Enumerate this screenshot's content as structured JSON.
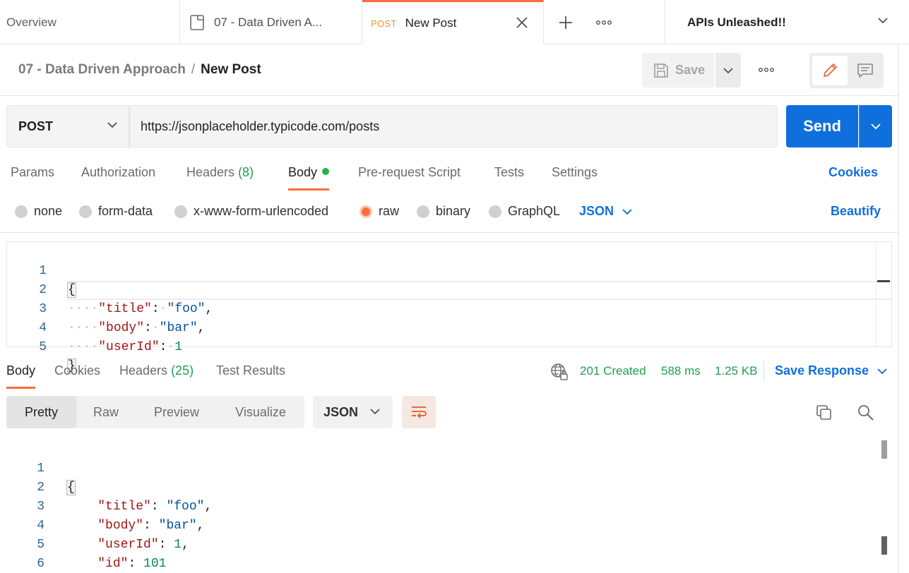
{
  "tabs": {
    "overview": "Overview",
    "collection": "07 - Data Driven A...",
    "new_post_method": "POST",
    "new_post": "New Post"
  },
  "workspace": "APIs Unleashed!!",
  "breadcrumb": {
    "collection": "07 - Data Driven Approach",
    "separator": "/",
    "request": "New Post"
  },
  "header": {
    "save_label": "Save"
  },
  "request": {
    "method": "POST",
    "url": "https://jsonplaceholder.typicode.com/posts",
    "send_label": "Send"
  },
  "request_tabs": [
    {
      "label": "Params"
    },
    {
      "label": "Authorization"
    },
    {
      "label": "Headers",
      "count": "(8)"
    },
    {
      "label": "Body"
    },
    {
      "label": "Pre-request Script"
    },
    {
      "label": "Tests"
    },
    {
      "label": "Settings"
    }
  ],
  "cookies_label": "Cookies",
  "body_types": [
    "none",
    "form-data",
    "x-www-form-urlencoded",
    "raw",
    "binary",
    "GraphQL"
  ],
  "body_format": "JSON",
  "beautify_label": "Beautify",
  "request_body_lines": [
    {
      "n": "1",
      "text": "{"
    },
    {
      "n": "2",
      "key": "\"title\"",
      "val": "\"foo\"",
      "end": ","
    },
    {
      "n": "3",
      "key": "\"body\"",
      "val": "\"bar\"",
      "end": ","
    },
    {
      "n": "4",
      "key": "\"userId\"",
      "num": "1",
      "end": ""
    },
    {
      "n": "5",
      "text": "}"
    }
  ],
  "response_tabs": [
    {
      "label": "Body"
    },
    {
      "label": "Cookies"
    },
    {
      "label": "Headers",
      "count": "(25)"
    },
    {
      "label": "Test Results"
    }
  ],
  "response_status": {
    "status": "201 Created",
    "time": "588 ms",
    "size": "1.25 KB"
  },
  "save_response_label": "Save Response",
  "view_modes": [
    "Pretty",
    "Raw",
    "Preview",
    "Visualize"
  ],
  "response_format": "JSON",
  "response_body_lines": [
    {
      "n": "1",
      "text": "{"
    },
    {
      "n": "2",
      "key": "\"title\"",
      "val": "\"foo\"",
      "end": ","
    },
    {
      "n": "3",
      "key": "\"body\"",
      "val": "\"bar\"",
      "end": ","
    },
    {
      "n": "4",
      "key": "\"userId\"",
      "num": "1",
      "end": ","
    },
    {
      "n": "5",
      "key": "\"id\"",
      "num": "101",
      "end": ""
    },
    {
      "n": "6",
      "text": "}"
    }
  ],
  "colors": {
    "accent": "#ff6c37",
    "primary": "#0f6fdd",
    "success": "#1f9d55",
    "method_post": "#f0942d"
  }
}
